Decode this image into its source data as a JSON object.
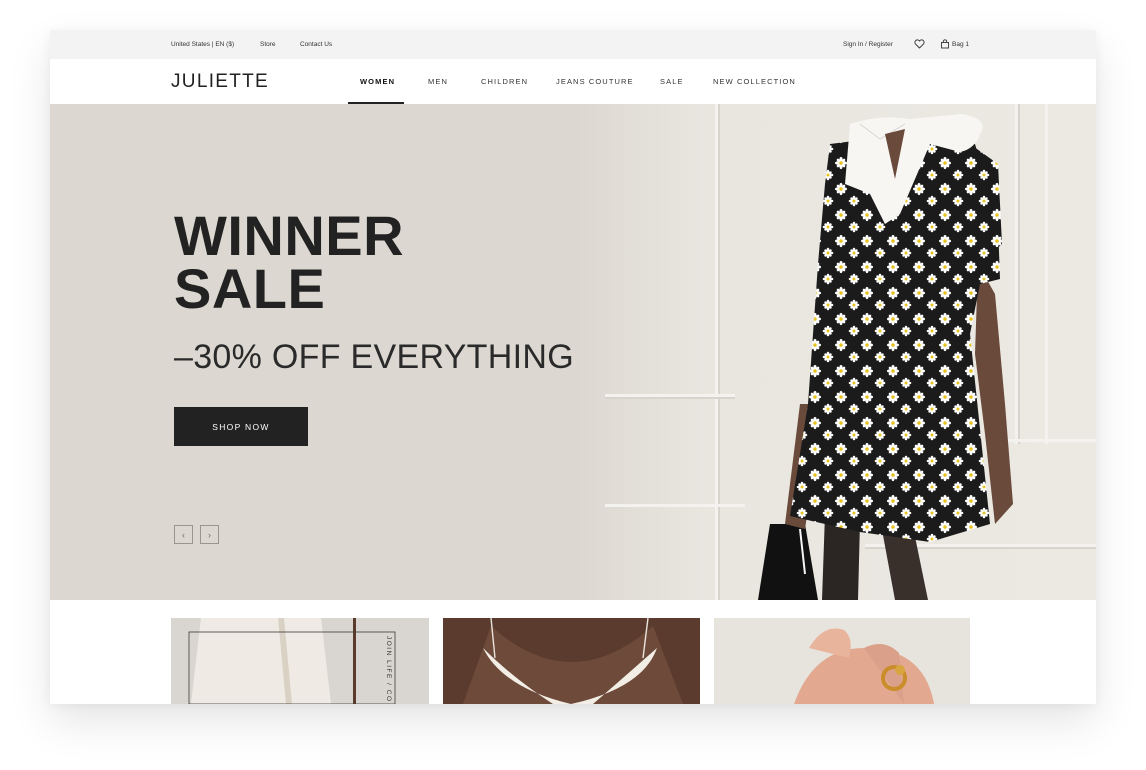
{
  "utility": {
    "locale": "United States | EN ($)",
    "store": "Store",
    "contact": "Contact Us",
    "sign_in": "Sign In / Register",
    "bag": "Bag 1"
  },
  "brand": {
    "logo": "JULIETTE"
  },
  "nav": [
    {
      "label": "WOMEN",
      "active": true
    },
    {
      "label": "MEN"
    },
    {
      "label": "CHILDREN"
    },
    {
      "label": "JEANS COUTURE"
    },
    {
      "label": "SALE"
    },
    {
      "label": "NEW COLLECTION"
    }
  ],
  "hero": {
    "title_line1": "WINNER",
    "title_line2": "SALE",
    "subtitle": "–30% OFF EVERYTHING",
    "cta": "SHOP NOW",
    "prev": "‹",
    "next": "›",
    "background": "#dcd8d1"
  },
  "cards": [
    {
      "caption": "JOIN LIFE / CO"
    },
    {
      "caption": ""
    },
    {
      "caption": ""
    }
  ],
  "colors": {
    "dark": "#222222",
    "hero_bg": "#dcd8d1",
    "accent_yellow": "#e7c320"
  }
}
